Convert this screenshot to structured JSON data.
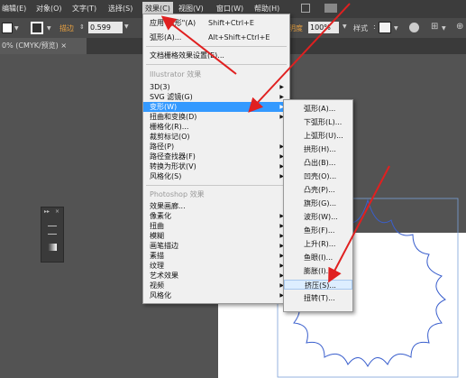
{
  "menubar": {
    "items": [
      "编辑(E)",
      "对象(O)",
      "文字(T)",
      "选择(S)",
      "效果(C)",
      "视图(V)",
      "窗口(W)",
      "帮助(H)"
    ]
  },
  "toolbar": {
    "stroke_label": "描边",
    "stroke_value": "0.599",
    "opacity_label": "明度",
    "opacity_value": "100%",
    "style_label": "样式"
  },
  "doc_tab": "0% (CMYK/预览)  ×",
  "effect_menu": {
    "top_items": [
      {
        "label": "应用\"弧形\"(A)",
        "shortcut": "Shift+Ctrl+E"
      },
      {
        "label": "弧形(A)...",
        "shortcut": "Alt+Shift+Ctrl+E"
      }
    ],
    "doc_raster": "文档栅格效果设置(E)...",
    "illustrator_header": "Illustrator 效果",
    "illustrator_items": [
      "3D(3)",
      "SVG 滤镜(G)",
      "变形(W)",
      "扭曲和变换(D)",
      "栅格化(R)...",
      "裁剪标记(O)",
      "路径(P)",
      "路径查找器(F)",
      "转换为形状(V)",
      "风格化(S)"
    ],
    "photoshop_header": "Photoshop 效果",
    "photoshop_items": [
      "效果画廊...",
      "像素化",
      "扭曲",
      "模糊",
      "画笔描边",
      "素描",
      "纹理",
      "艺术效果",
      "视频",
      "风格化"
    ]
  },
  "warp_menu": {
    "items": [
      "弧形(A)...",
      "下弧形(L)...",
      "上弧形(U)...",
      "拱形(H)...",
      "凸出(B)...",
      "凹壳(O)...",
      "凸壳(P)...",
      "旗形(G)...",
      "波形(W)...",
      "鱼形(F)...",
      "上升(R)...",
      "鱼眼(I)...",
      "膨胀(I)...",
      "挤压(S)...",
      "扭转(T)..."
    ]
  },
  "colors": {
    "highlight": "#3399ff",
    "arrow": "#e02020",
    "shape_stroke": "#3a5fcd"
  }
}
